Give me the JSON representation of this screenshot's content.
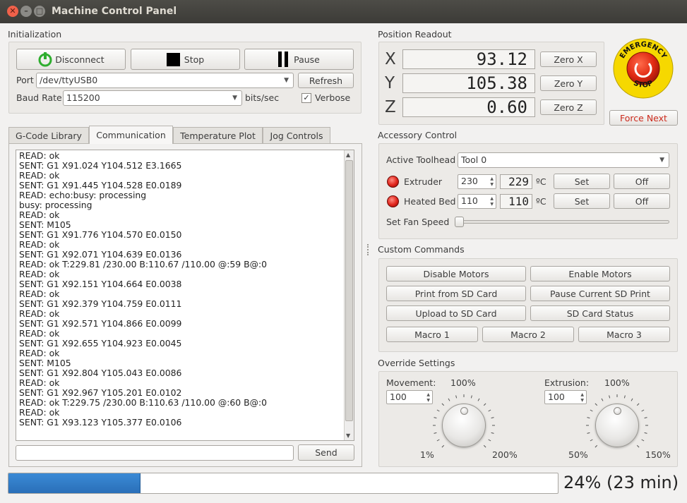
{
  "window": {
    "title": "Machine Control Panel"
  },
  "initialization": {
    "label": "Initialization",
    "disconnect_label": "Disconnect",
    "stop_label": "Stop",
    "pause_label": "Pause",
    "port_label": "Port",
    "port_value": "/dev/ttyUSB0",
    "refresh_label": "Refresh",
    "baud_label": "Baud Rate",
    "baud_value": "115200",
    "baud_unit": "bits/sec",
    "verbose_label": "Verbose",
    "verbose_checked": true
  },
  "tabs": [
    {
      "label": "G-Code Library"
    },
    {
      "label": "Communication"
    },
    {
      "label": "Temperature Plot"
    },
    {
      "label": "Jog Controls"
    }
  ],
  "log_lines": [
    "READ: ok",
    "SENT: G1 X91.024 Y104.512 E3.1665",
    "READ: ok",
    "SENT: G1 X91.445 Y104.528 E0.0189",
    "READ: echo:busy: processing",
    "busy: processing",
    "READ: ok",
    "SENT: M105",
    "SENT: G1 X91.776 Y104.570 E0.0150",
    "READ: ok",
    "SENT: G1 X92.071 Y104.639 E0.0136",
    "READ: ok T:229.81 /230.00 B:110.67 /110.00 @:59 B@:0",
    "READ: ok",
    "SENT: G1 X92.151 Y104.664 E0.0038",
    "READ: ok",
    "SENT: G1 X92.379 Y104.759 E0.0111",
    "READ: ok",
    "SENT: G1 X92.571 Y104.866 E0.0099",
    "READ: ok",
    "SENT: G1 X92.655 Y104.923 E0.0045",
    "READ: ok",
    "SENT: M105",
    "SENT: G1 X92.804 Y105.043 E0.0086",
    "READ: ok",
    "SENT: G1 X92.967 Y105.201 E0.0102",
    "READ: ok T:229.75 /230.00 B:110.63 /110.00 @:60 B@:0",
    "READ: ok",
    "SENT: G1 X93.123 Y105.377 E0.0106"
  ],
  "command_input": {
    "value": "",
    "send_label": "Send"
  },
  "position": {
    "label": "Position Readout",
    "axes": [
      {
        "name": "X",
        "value": "93.12",
        "zero_label": "Zero X"
      },
      {
        "name": "Y",
        "value": "105.38",
        "zero_label": "Zero Y"
      },
      {
        "name": "Z",
        "value": "0.60",
        "zero_label": "Zero Z"
      }
    ]
  },
  "emergency": {
    "top_text": "EMERGENCY",
    "bottom_text": "STOP",
    "force_next_label": "Force Next",
    "force_next_color": "#cc2b1d"
  },
  "accessory": {
    "label": "Accessory Control",
    "toolhead_label": "Active Toolhead",
    "toolhead_value": "Tool 0",
    "extruder": {
      "label": "Extruder",
      "target": "230",
      "current": "229",
      "unit": "ºC",
      "set_label": "Set",
      "off_label": "Off"
    },
    "bed": {
      "label": "Heated Bed",
      "target": "110",
      "current": "110",
      "unit": "ºC",
      "set_label": "Set",
      "off_label": "Off"
    },
    "fan_label": "Set Fan Speed",
    "fan_value": 0
  },
  "custom_commands": {
    "label": "Custom Commands",
    "row1": [
      "Disable Motors",
      "Enable Motors"
    ],
    "row2": [
      "Print from SD Card",
      "Pause Current SD Print"
    ],
    "row3": [
      "Upload to SD Card",
      "SD Card Status"
    ],
    "macros": [
      "Macro 1",
      "Macro 2",
      "Macro 3"
    ]
  },
  "override": {
    "label": "Override Settings",
    "movement": {
      "label": "Movement:",
      "value": "100",
      "top": "100%",
      "min": "1%",
      "max": "200%"
    },
    "extrusion": {
      "label": "Extrusion:",
      "value": "100",
      "top": "100%",
      "min": "50%",
      "max": "150%"
    }
  },
  "progress": {
    "percent": 24,
    "text": "24% (23 min)",
    "fill_color": "#3a8ad6"
  }
}
